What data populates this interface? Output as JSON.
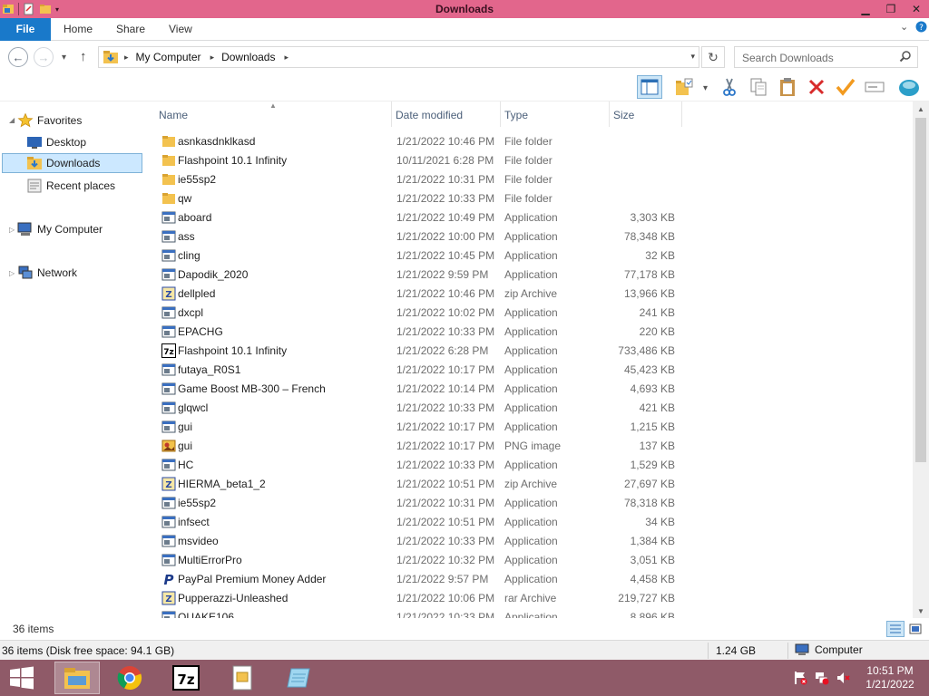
{
  "window": {
    "title": "Downloads"
  },
  "ribbon": {
    "tabs": [
      "File",
      "Home",
      "Share",
      "View"
    ]
  },
  "address": {
    "path": [
      "My Computer",
      "Downloads"
    ]
  },
  "search": {
    "placeholder": "Search Downloads"
  },
  "nav": {
    "favorites": "Favorites",
    "desktop": "Desktop",
    "downloads": "Downloads",
    "recent": "Recent places",
    "computer": "My Computer",
    "network": "Network"
  },
  "columns": {
    "name": "Name",
    "date": "Date modified",
    "type": "Type",
    "size": "Size"
  },
  "files": [
    {
      "name": "asnkasdnklkasd",
      "date": "1/21/2022 10:46 PM",
      "type": "File folder",
      "size": "",
      "icon": "folder-icon"
    },
    {
      "name": "Flashpoint 10.1 Infinity",
      "date": "10/11/2021 6:28 PM",
      "type": "File folder",
      "size": "",
      "icon": "folder-icon"
    },
    {
      "name": "ie55sp2",
      "date": "1/21/2022 10:31 PM",
      "type": "File folder",
      "size": "",
      "icon": "folder-icon"
    },
    {
      "name": "qw",
      "date": "1/21/2022 10:33 PM",
      "type": "File folder",
      "size": "",
      "icon": "folder-icon"
    },
    {
      "name": "aboard",
      "date": "1/21/2022 10:49 PM",
      "type": "Application",
      "size": "3,303 KB",
      "icon": "app-icon"
    },
    {
      "name": "ass",
      "date": "1/21/2022 10:00 PM",
      "type": "Application",
      "size": "78,348 KB",
      "icon": "app-icon"
    },
    {
      "name": "cling",
      "date": "1/21/2022 10:45 PM",
      "type": "Application",
      "size": "32 KB",
      "icon": "app-icon"
    },
    {
      "name": "Dapodik_2020",
      "date": "1/21/2022 9:59 PM",
      "type": "Application",
      "size": "77,178 KB",
      "icon": "app-icon"
    },
    {
      "name": "dellpled",
      "date": "1/21/2022 10:46 PM",
      "type": "zip Archive",
      "size": "13,966 KB",
      "icon": "archive-icon"
    },
    {
      "name": "dxcpl",
      "date": "1/21/2022 10:02 PM",
      "type": "Application",
      "size": "241 KB",
      "icon": "app-icon"
    },
    {
      "name": "EPACHG",
      "date": "1/21/2022 10:33 PM",
      "type": "Application",
      "size": "220 KB",
      "icon": "app-icon"
    },
    {
      "name": "Flashpoint 10.1 Infinity",
      "date": "1/21/2022 6:28 PM",
      "type": "Application",
      "size": "733,486 KB",
      "icon": "7z-icon"
    },
    {
      "name": "futaya_R0S1",
      "date": "1/21/2022 10:17 PM",
      "type": "Application",
      "size": "45,423 KB",
      "icon": "app-icon"
    },
    {
      "name": "Game Boost MB-300 – French",
      "date": "1/21/2022 10:14 PM",
      "type": "Application",
      "size": "4,693 KB",
      "icon": "app-icon"
    },
    {
      "name": "glqwcl",
      "date": "1/21/2022 10:33 PM",
      "type": "Application",
      "size": "421 KB",
      "icon": "app-icon"
    },
    {
      "name": "gui",
      "date": "1/21/2022 10:17 PM",
      "type": "Application",
      "size": "1,215 KB",
      "icon": "app-icon"
    },
    {
      "name": "gui",
      "date": "1/21/2022 10:17 PM",
      "type": "PNG image",
      "size": "137 KB",
      "icon": "image-icon"
    },
    {
      "name": "HC",
      "date": "1/21/2022 10:33 PM",
      "type": "Application",
      "size": "1,529 KB",
      "icon": "app-icon"
    },
    {
      "name": "HIERMA_beta1_2",
      "date": "1/21/2022 10:51 PM",
      "type": "zip Archive",
      "size": "27,697 KB",
      "icon": "archive-icon"
    },
    {
      "name": "ie55sp2",
      "date": "1/21/2022 10:31 PM",
      "type": "Application",
      "size": "78,318 KB",
      "icon": "app-icon"
    },
    {
      "name": "infsect",
      "date": "1/21/2022 10:51 PM",
      "type": "Application",
      "size": "34 KB",
      "icon": "app-icon"
    },
    {
      "name": "msvideo",
      "date": "1/21/2022 10:33 PM",
      "type": "Application",
      "size": "1,384 KB",
      "icon": "app-icon"
    },
    {
      "name": "MultiErrorPro",
      "date": "1/21/2022 10:32 PM",
      "type": "Application",
      "size": "3,051 KB",
      "icon": "app-icon"
    },
    {
      "name": "PayPal Premium Money Adder",
      "date": "1/21/2022 9:57 PM",
      "type": "Application",
      "size": "4,458 KB",
      "icon": "paypal-icon"
    },
    {
      "name": "Pupperazzi-Unleashed",
      "date": "1/21/2022 10:06 PM",
      "type": "rar Archive",
      "size": "219,727 KB",
      "icon": "archive-icon"
    },
    {
      "name": "QUAKE106",
      "date": "1/21/2022 10:33 PM",
      "type": "Application",
      "size": "8,896 KB",
      "icon": "app-icon"
    }
  ],
  "items_count": "36 items",
  "status": {
    "left": "36 items (Disk free space: 94.1 GB)",
    "size": "1.24 GB",
    "location": "Computer"
  },
  "taskbar": {
    "apps": [
      "file-explorer-icon",
      "chrome-icon",
      "7zip-icon",
      "documents-icon",
      "notepad-icon"
    ],
    "time": "10:51 PM",
    "date": "1/21/2022"
  },
  "colors": {
    "title_bar": "#e2668c",
    "file_tab": "#1979ca",
    "taskbar": "#8f5a68",
    "selection": "#cce8ff"
  }
}
